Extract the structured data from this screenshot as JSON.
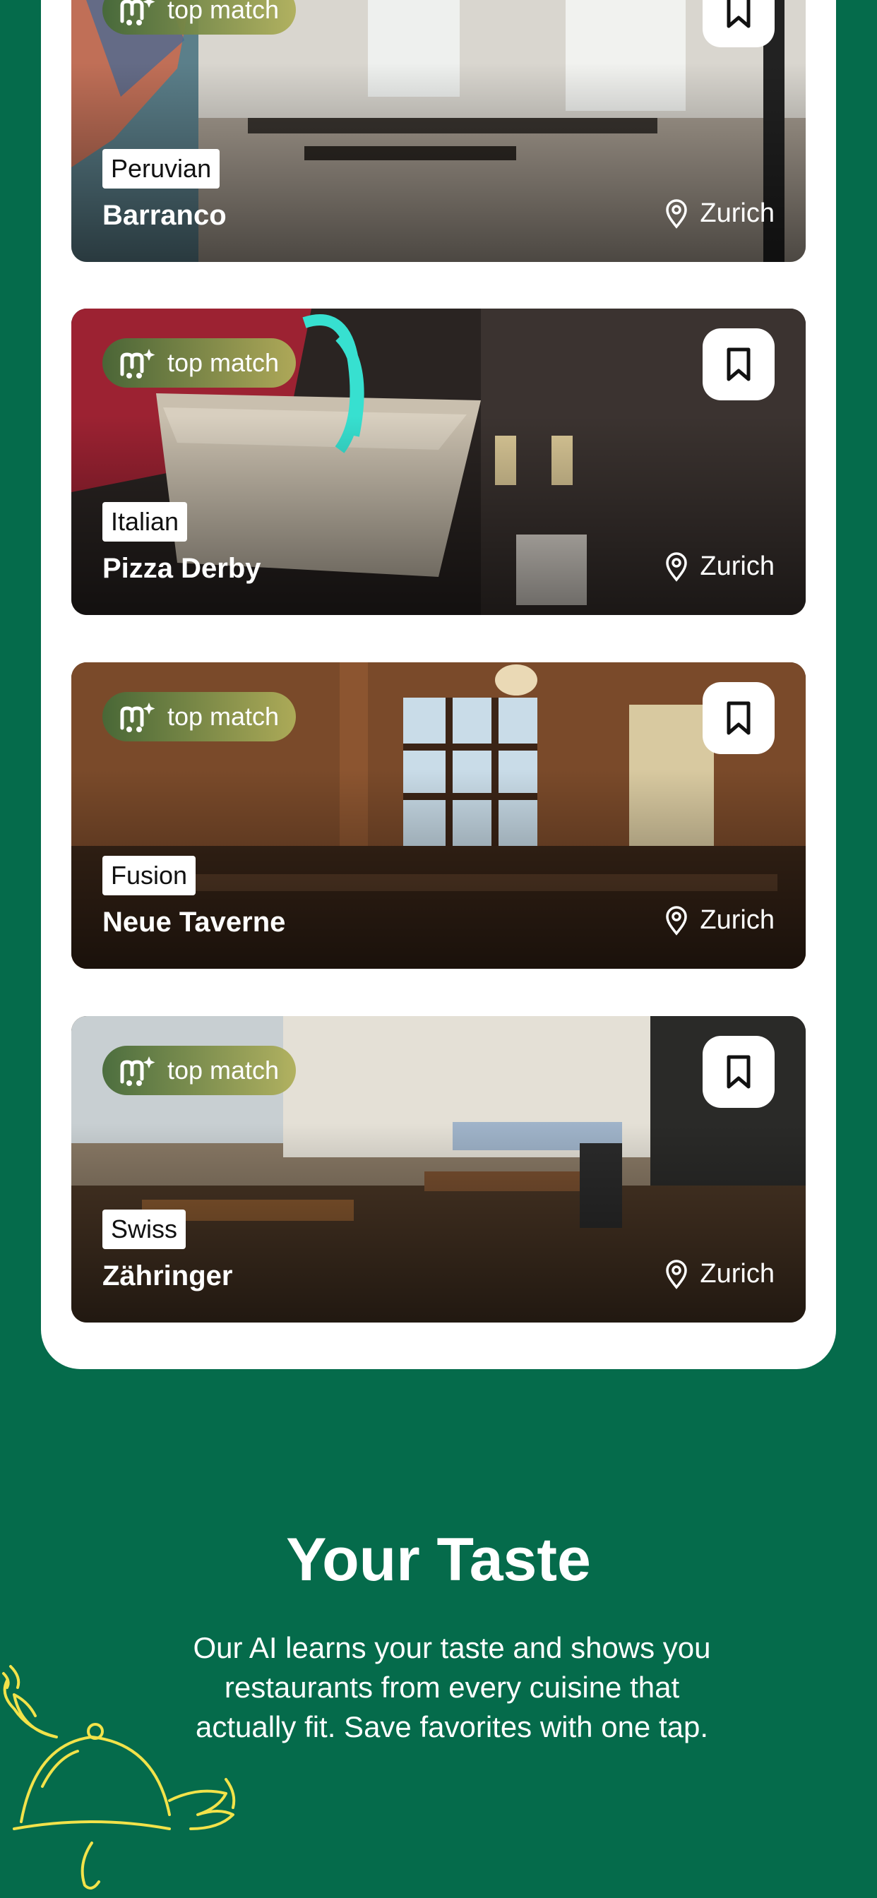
{
  "match_badge_label": "top match",
  "restaurants": [
    {
      "name": "Barranco",
      "cuisine": "Peruvian",
      "location": "Zurich"
    },
    {
      "name": "Pizza Derby",
      "cuisine": "Italian",
      "location": "Zurich"
    },
    {
      "name": "Neue Taverne",
      "cuisine": "Fusion",
      "location": "Zurich"
    },
    {
      "name": "Zähringer",
      "cuisine": "Swiss",
      "location": "Zurich"
    }
  ],
  "feature": {
    "title": "Your Taste",
    "description": "Our AI learns your taste and shows you restaurants from every cuisine that actually fit. Save favorites with one tap."
  },
  "colors": {
    "background": "#056b4b",
    "panel": "#ffffff",
    "accent": "#f2e34a"
  },
  "icons": [
    "sparkle-logo-icon",
    "bookmark-icon",
    "location-pin-icon",
    "winged-cloche-icon"
  ]
}
